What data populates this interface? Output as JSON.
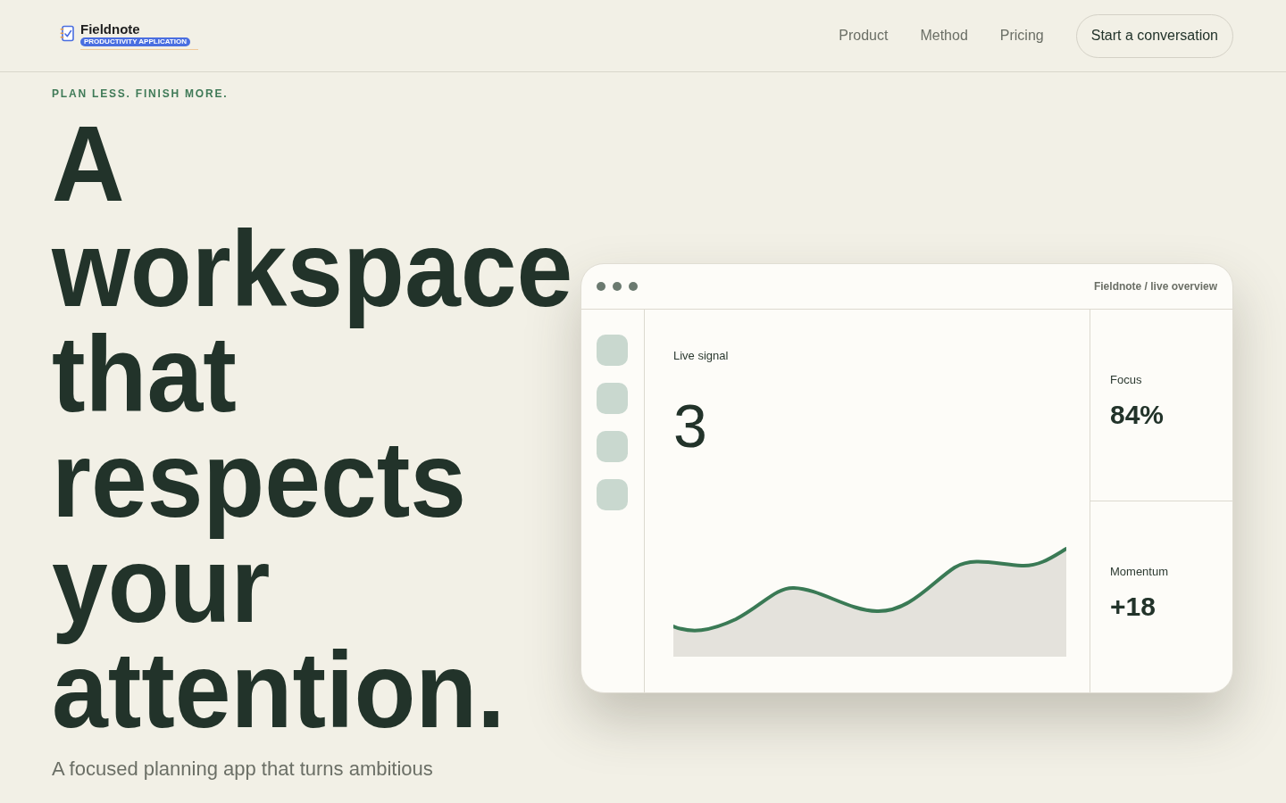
{
  "header": {
    "logo": {
      "name": "Fieldnote",
      "badge": "PRODUCTIVITY APPLICATION"
    },
    "nav": [
      {
        "label": "Product"
      },
      {
        "label": "Method"
      },
      {
        "label": "Pricing"
      }
    ],
    "cta": "Start a conversation"
  },
  "hero": {
    "eyebrow": "PLAN LESS. FINISH MORE.",
    "headline": "A workspace that respects your attention.",
    "subtitle": "A focused planning app that turns ambitious"
  },
  "preview": {
    "title": "Fieldnote / live overview",
    "signal": {
      "label": "Live signal",
      "value": "3"
    },
    "stats": [
      {
        "label": "Focus",
        "value": "84%"
      },
      {
        "label": "Momentum",
        "value": "+18"
      }
    ]
  }
}
